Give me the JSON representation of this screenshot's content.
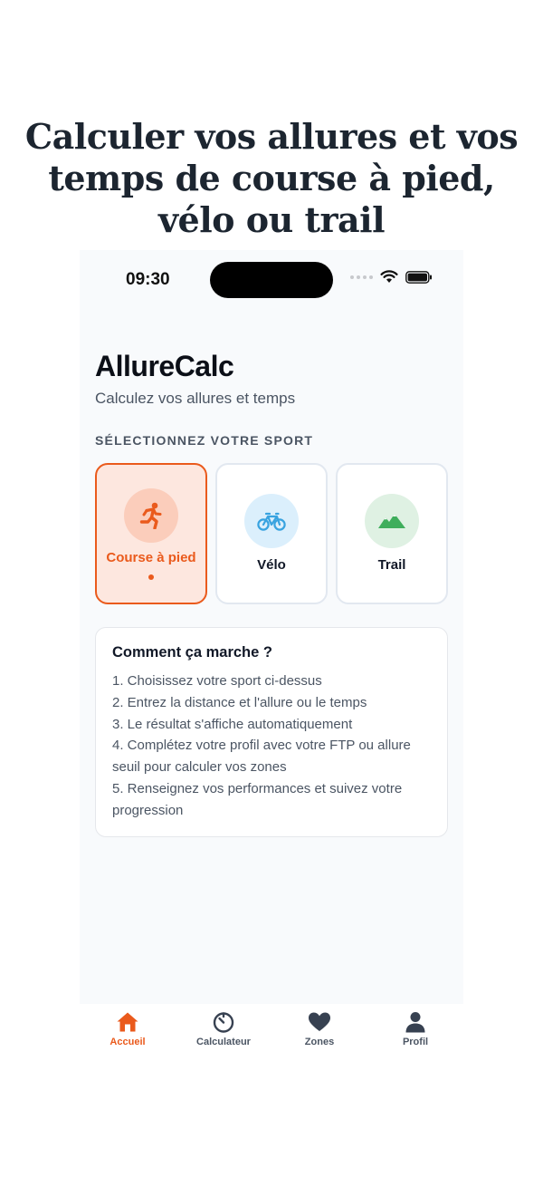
{
  "headline": [
    "Calculer vos allures et vos",
    "temps de course à pied,",
    "vélo ou trail"
  ],
  "status_bar": {
    "time": "09:30"
  },
  "app": {
    "title": "AllureCalc",
    "subtitle": "Calculez vos allures et temps",
    "section_label": "SÉLECTIONNEZ VOTRE SPORT"
  },
  "sports": [
    {
      "label": "Course à pied",
      "icon": "runner-icon",
      "selected": true
    },
    {
      "label": "Vélo",
      "icon": "bike-icon",
      "selected": false
    },
    {
      "label": "Trail",
      "icon": "mountain-icon",
      "selected": false
    }
  ],
  "how_it_works": {
    "title": "Comment ça marche ?",
    "steps": [
      "1. Choisissez votre sport ci-dessus",
      "2. Entrez la distance et l'allure ou le temps",
      "3. Le résultat s'affiche automatiquement",
      "4. Complétez votre profil avec votre FTP ou allure",
      "seuil pour calculer vos zones",
      "5. Renseignez vos performances et suivez votre",
      "progression"
    ]
  },
  "tabbar": [
    {
      "label": "Accueil",
      "icon": "home-icon",
      "active": true
    },
    {
      "label": "Calculateur",
      "icon": "timer-icon",
      "active": false
    },
    {
      "label": "Zones",
      "icon": "heart-icon",
      "active": false
    },
    {
      "label": "Profil",
      "icon": "user-icon",
      "active": false
    }
  ],
  "colors": {
    "accent": "#ea5a1c",
    "bike": "#38a3e0",
    "trail": "#3fae5c"
  }
}
